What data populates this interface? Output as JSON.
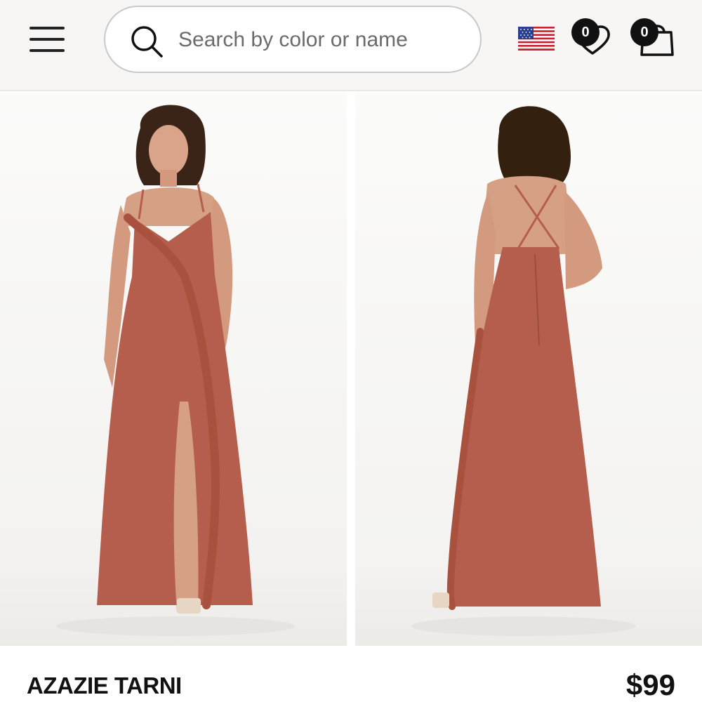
{
  "header": {
    "search": {
      "placeholder": "Search by color or name",
      "value": ""
    },
    "wishlist_count": "0",
    "cart_count": "0",
    "icons": {
      "menu": "hamburger-menu-icon",
      "search": "search-icon",
      "country": "us-flag-icon",
      "wishlist": "heart-icon",
      "cart": "shopping-bag-icon"
    }
  },
  "gallery": {
    "images": [
      {
        "view": "front",
        "color": "#b65e4d"
      },
      {
        "view": "back",
        "color": "#b65e4d"
      }
    ]
  },
  "product": {
    "name": "AZAZIE TARNI",
    "price": "$99"
  },
  "colors": {
    "dress": "#b65e4d",
    "text": "#111111",
    "header_bg": "#f7f6f4"
  }
}
